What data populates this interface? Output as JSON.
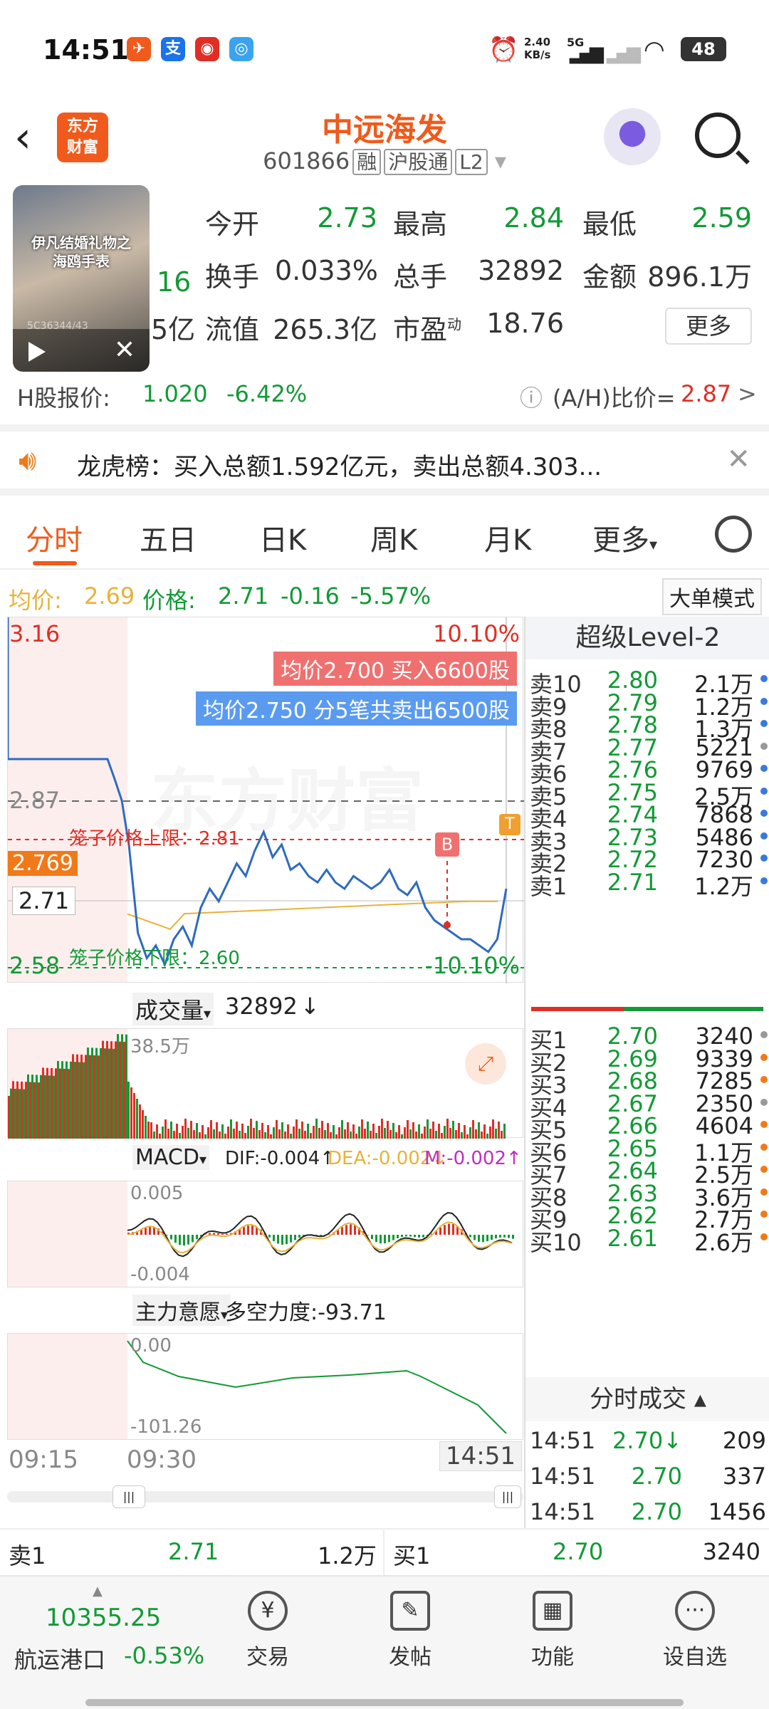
{
  "status_bar": {
    "time": "14:51",
    "net_speed": "2.40\nKB/s",
    "net_type": "5G",
    "battery": "48"
  },
  "header": {
    "stock_name": "中远海发",
    "stock_code": "601866",
    "tags": [
      "融",
      "沪股通",
      "L2"
    ],
    "logo_text": "东方\n财富"
  },
  "quote": {
    "today_open_label": "今开",
    "today_open": "2.73",
    "high_label": "最高",
    "high": "2.84",
    "low_label": "最低",
    "low": "2.59",
    "turnover_label": "换手",
    "turnover": "0.033%",
    "total_vol_label": "总手",
    "total_vol": "32892",
    "amount_label": "金额",
    "amount": "896.1万",
    "float_cap_label": "流值",
    "float_cap": "265.3亿",
    "pe_label": "市盈",
    "pe_sup": "动",
    "pe": "18.76",
    "more_label": "更多",
    "partial_price": "16",
    "partial_cap": "5亿"
  },
  "video": {
    "caption": "伊凡结婚礼物之\n海鸥手表",
    "watermark": "5C36344/43"
  },
  "hshare": {
    "label": "H股报价:",
    "price": "1.020",
    "change": "-6.42%",
    "ah_label": "(A/H)比价=",
    "ah_value": "2.87",
    "arrow": ">"
  },
  "lhb": {
    "text": "龙虎榜：买入总额1.592亿元，卖出总额4.303..."
  },
  "tabs": [
    "分时",
    "五日",
    "日K",
    "周K",
    "月K",
    "更多"
  ],
  "info_row": {
    "avg_label": "均价:",
    "avg": "2.69",
    "price_label": "价格:",
    "price": "2.71",
    "chg": "-0.16",
    "pct": "-5.57%",
    "big_order_mode": "大单模式"
  },
  "chart": {
    "y_top": "3.16",
    "y_top_pct": "10.10%",
    "y_bottom": "2.58",
    "y_bottom_pct": "-10.10%",
    "prev_close": "2.87",
    "cursor_price": "2.769",
    "last_price": "2.71",
    "buy_badge": "均价2.700  买入6600股",
    "sell_badge": "均价2.750  分5笔共卖出6500股",
    "cage_upper": "笼子价格上限：2.81",
    "cage_lower": "笼子价格下限：2.60",
    "watermark": "东方财富",
    "b_marker": "B",
    "t_marker": "T",
    "volume_label": "成交量",
    "volume_value": "32892",
    "volume_arrow": "↓",
    "volume_max": "38.5万",
    "macd_label": "MACD",
    "dif": "DIF:-0.004",
    "dif_arrow": "↑",
    "dea": "DEA:-0.002",
    "dea_arrow": "↓",
    "m": "M:-0.002",
    "m_arrow": "↑",
    "macd_top": "0.005",
    "macd_bottom": "-0.004",
    "main_label": "主力意愿",
    "main_force": "多空力度:-93.71",
    "main_top": "0.00",
    "main_bottom": "-101.26",
    "time_start": "09:15",
    "time_open": "09:30",
    "time_now": "14:51",
    "colors": {
      "up": "#e02e24",
      "down": "#119a35",
      "price_line": "#2e6bbf",
      "avg_line": "#e8b23a"
    }
  },
  "chart_data": {
    "type": "line",
    "title": "",
    "x": [
      "09:15",
      "09:30",
      "14:51"
    ],
    "series": [
      {
        "name": "价格",
        "values": [
          3.16,
          2.87,
          2.71
        ]
      },
      {
        "name": "均价",
        "values": [
          2.69,
          2.69,
          2.69
        ]
      }
    ],
    "ylim": [
      2.58,
      3.16
    ]
  },
  "order_book": {
    "title": "超级Level-2",
    "sells": [
      {
        "name": "卖10",
        "price": "2.80",
        "vol": "2.1万",
        "dot": "#3a7ad9"
      },
      {
        "name": "卖9",
        "price": "2.79",
        "vol": "1.2万",
        "dot": "#3a7ad9"
      },
      {
        "name": "卖8",
        "price": "2.78",
        "vol": "1.3万",
        "dot": "#3a7ad9"
      },
      {
        "name": "卖7",
        "price": "2.77",
        "vol": "5221",
        "dot": "#999999"
      },
      {
        "name": "卖6",
        "price": "2.76",
        "vol": "9769",
        "dot": "#3a7ad9"
      },
      {
        "name": "卖5",
        "price": "2.75",
        "vol": "2.5万",
        "dot": "#3a7ad9"
      },
      {
        "name": "卖4",
        "price": "2.74",
        "vol": "7868",
        "dot": "#3a7ad9"
      },
      {
        "name": "卖3",
        "price": "2.73",
        "vol": "5486",
        "dot": "#3a7ad9"
      },
      {
        "name": "卖2",
        "price": "2.72",
        "vol": "7230",
        "dot": "#3a7ad9"
      },
      {
        "name": "卖1",
        "price": "2.71",
        "vol": "1.2万",
        "dot": "#3a7ad9"
      }
    ],
    "buys": [
      {
        "name": "买1",
        "price": "2.70",
        "vol": "3240",
        "dot": "#999999"
      },
      {
        "name": "买2",
        "price": "2.69",
        "vol": "9339",
        "dot": "#f07a1a"
      },
      {
        "name": "买3",
        "price": "2.68",
        "vol": "7285",
        "dot": "#f07a1a"
      },
      {
        "name": "买4",
        "price": "2.67",
        "vol": "2350",
        "dot": "#999999"
      },
      {
        "name": "买5",
        "price": "2.66",
        "vol": "4604",
        "dot": "#f07a1a"
      },
      {
        "name": "买6",
        "price": "2.65",
        "vol": "1.1万",
        "dot": "#f07a1a"
      },
      {
        "name": "买7",
        "price": "2.64",
        "vol": "2.5万",
        "dot": "#f07a1a"
      },
      {
        "name": "买8",
        "price": "2.63",
        "vol": "3.6万",
        "dot": "#f07a1a"
      },
      {
        "name": "买9",
        "price": "2.62",
        "vol": "2.7万",
        "dot": "#f07a1a"
      },
      {
        "name": "买10",
        "price": "2.61",
        "vol": "2.6万",
        "dot": "#f07a1a"
      }
    ],
    "tick_title": "分时成交",
    "ticks": [
      {
        "time": "14:51",
        "price": "2.70",
        "arrow": "↓",
        "vol": "209"
      },
      {
        "time": "14:51",
        "price": "2.70",
        "arrow": "",
        "vol": "337"
      },
      {
        "time": "14:51",
        "price": "2.70",
        "arrow": "",
        "vol": "1456"
      }
    ]
  },
  "quick_bar": {
    "sell1_label": "卖1",
    "sell1_price": "2.71",
    "sell1_vol": "1.2万",
    "buy1_label": "买1",
    "buy1_price": "2.70",
    "buy1_vol": "3240"
  },
  "bottom_nav": {
    "index_value": "10355.25",
    "index_name": "航运港口",
    "index_change": "-0.53%",
    "items": [
      "交易",
      "发帖",
      "功能",
      "设自选"
    ]
  }
}
